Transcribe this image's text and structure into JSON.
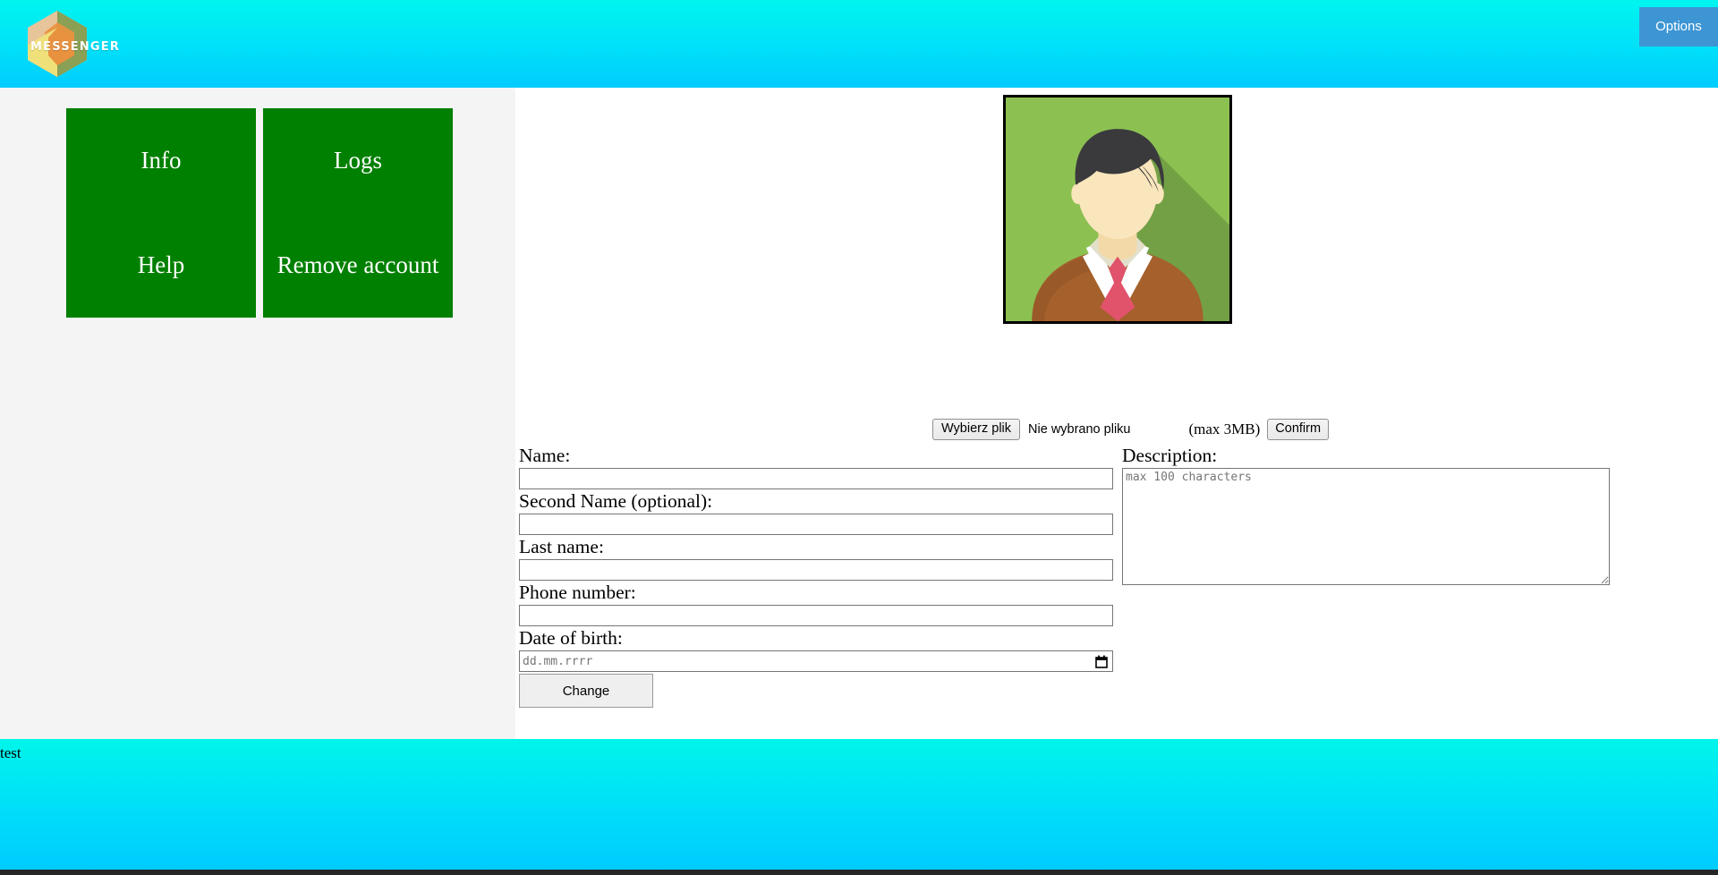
{
  "header": {
    "logo_text": "MESSENGER",
    "logo_icon": "hexagon-logo-icon",
    "options_label": "Options",
    "gradient_top": "#00F5EF",
    "gradient_bottom": "#00CCFF",
    "options_bg": "#3D95D4"
  },
  "sidebar": {
    "background": "#F4F4F4",
    "buttons": [
      {
        "label": "Info",
        "name": "info"
      },
      {
        "label": "Logs",
        "name": "logs"
      },
      {
        "label": "Help",
        "name": "help"
      },
      {
        "label": "Remove account",
        "name": "remove-account"
      }
    ],
    "button_color": "#008000"
  },
  "main": {
    "avatar": {
      "alt": "user-avatar",
      "background": "#8CC152",
      "shadow": "#6E9A43",
      "hair": "#3A3A3C",
      "skin": "#FAE6BC",
      "sweater": "#A5602C",
      "shirt": "#FFFFFF",
      "collar": "#E2DFCB",
      "tie": "#E0536B"
    },
    "upload": {
      "file_button_label": "Wybierz plik",
      "file_status": "Nie wybrano pliku",
      "max_size_note": "(max 3MB)",
      "confirm_label": "Confirm"
    },
    "form": {
      "fields": [
        {
          "label": "Name:",
          "value": "",
          "placeholder": "",
          "name": "name"
        },
        {
          "label": "Second Name (optional):",
          "value": "",
          "placeholder": "",
          "name": "second-name"
        },
        {
          "label": "Last name:",
          "value": "",
          "placeholder": "",
          "name": "last-name"
        },
        {
          "label": "Phone number:",
          "value": "",
          "placeholder": "",
          "name": "phone-number"
        }
      ],
      "date_label": "Date of birth:",
      "date_placeholder": "dd.mm.rrrr",
      "date_value": "",
      "submit_label": "Change",
      "description_label": "Description:",
      "description_placeholder": "max 100 characters",
      "description_value": ""
    }
  },
  "footer": {
    "text": "test",
    "gradient_top": "#00F5EA",
    "gradient_bottom": "#00CBFF",
    "bottom_bar_color": "#262626"
  }
}
